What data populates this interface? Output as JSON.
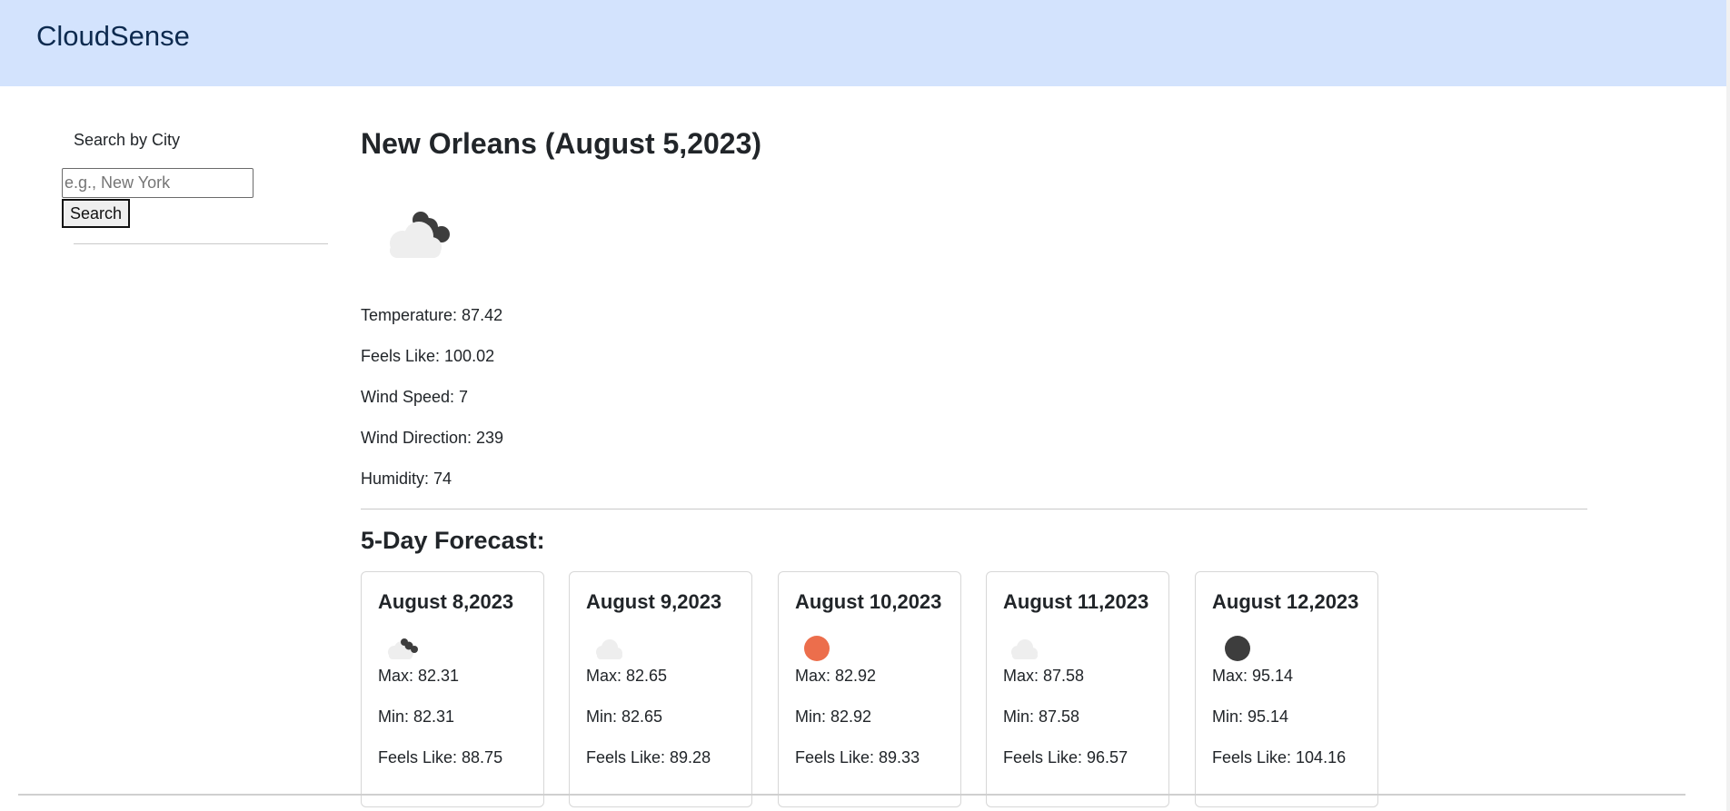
{
  "app": {
    "title": "CloudSense"
  },
  "sidebar": {
    "label": "Search by City",
    "input_placeholder": "e.g., New York",
    "button_label": "Search"
  },
  "current": {
    "title": "New Orleans (August 5,2023)",
    "icon": "partly-cloudy-dark-cloud-icon",
    "details": [
      "Temperature: 87.42",
      "Feels Like: 100.02",
      "Wind Speed: 7",
      "Wind Direction: 239",
      "Humidity: 74"
    ]
  },
  "forecast": {
    "title": "5-Day Forecast:",
    "days": [
      {
        "date": "August 8,2023",
        "icon": "broken-clouds-icon",
        "max": "Max: 82.31",
        "min": "Min: 82.31",
        "feels": "Feels Like: 88.75"
      },
      {
        "date": "August 9,2023",
        "icon": "cloud-icon",
        "max": "Max: 82.65",
        "min": "Min: 82.65",
        "feels": "Feels Like: 89.28"
      },
      {
        "date": "August 10,2023",
        "icon": "sun-icon",
        "max": "Max: 82.92",
        "min": "Min: 82.92",
        "feels": "Feels Like: 89.33"
      },
      {
        "date": "August 11,2023",
        "icon": "cloud-icon",
        "max": "Max: 87.58",
        "min": "Min: 87.58",
        "feels": "Feels Like: 96.57"
      },
      {
        "date": "August 12,2023",
        "icon": "moon-icon",
        "max": "Max: 95.14",
        "min": "Min: 95.14",
        "feels": "Feels Like: 104.16"
      }
    ]
  },
  "colors": {
    "header_bg": "#d3e3fd",
    "sun": "#ec6e4c",
    "dark_cloud": "#3d3d3d",
    "light_cloud": "#eeeeee"
  }
}
